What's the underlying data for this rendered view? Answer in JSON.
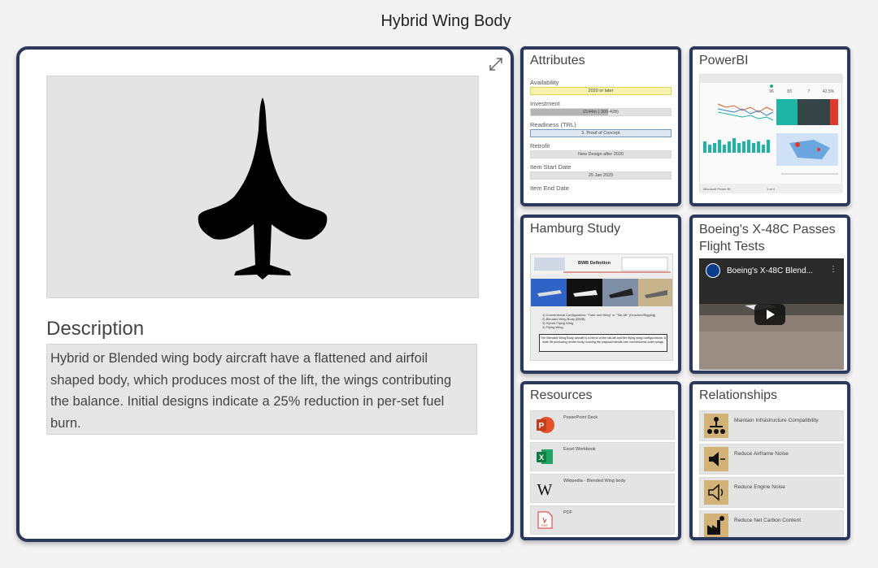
{
  "page": {
    "title": "Hybrid Wing Body"
  },
  "main": {
    "description_label": "Description",
    "description_text": "Hybrid or Blended wing body aircraft have a flattened and airfoil shaped body, which produces most of the lift, the wings contributing the balance. Initial designs indicate a 25% reduction in per-set fuel burn."
  },
  "attributes": {
    "title": "Attributes",
    "items": [
      {
        "label": "Availability",
        "value": "2020 or later"
      },
      {
        "label": "Investment",
        "value": "£544m ( 300-428)",
        "fill_fraction": 0.55
      },
      {
        "label": "Readiness (TRL)",
        "value": "3. Proof of Concept"
      },
      {
        "label": "Retrofit",
        "value": "New Design after 2020"
      },
      {
        "label": "Item Start Date",
        "value": "25 Jan 2025"
      },
      {
        "label": "Item End Date",
        "value": ""
      }
    ]
  },
  "powerbi": {
    "title": "PowerBI",
    "footer_left": "Microsoft Power BI",
    "footer_page": "1 of 4",
    "kpis": [
      "96",
      "83",
      "7",
      "42.5%"
    ]
  },
  "hamburg": {
    "title": "Hamburg Study",
    "slide_title": "BWB Definition",
    "slide_list": [
      "1) Conventional Configuration: \"Tube and Wing\" or \"Tail-Aft\" (Drachen/Rigging)",
      "2) Blended Wing Body (BWB)",
      "3) Hybrid Flying Wing",
      "4) Flying Wing"
    ],
    "slide_box": "The Blended Wing Body aircraft is a blend of the tail-aft and the flying wing configurations: A wide lift producing center body housing the payload blends into conventional outer wings."
  },
  "boeing": {
    "title": "Boeing's X-48C Passes Flight Tests",
    "video_title": "Boeing's X-48C Blend..."
  },
  "resources": {
    "title": "Resources",
    "items": [
      {
        "label": "PowerPoint Deck",
        "icon": "powerpoint-icon"
      },
      {
        "label": "Excel Workbook",
        "icon": "excel-icon"
      },
      {
        "label": "Wikipedia - Blended Wing body",
        "icon": "wikipedia-icon"
      },
      {
        "label": "PDF",
        "icon": "pdf-icon"
      }
    ]
  },
  "relationships": {
    "title": "Relationships",
    "items": [
      {
        "label": "Maintain Infrastructure Compatibility",
        "icon": "hierarchy-icon"
      },
      {
        "label": "Reduce Airframe Noise",
        "icon": "speaker-icon"
      },
      {
        "label": "Reduce Engine Noise",
        "icon": "speaker-outline-icon"
      },
      {
        "label": "Reduce Net Carbon Content",
        "icon": "factory-icon"
      }
    ]
  },
  "colors": {
    "card_border": "#2b3a5c",
    "relationship_icon_bg": "#d2b277"
  }
}
